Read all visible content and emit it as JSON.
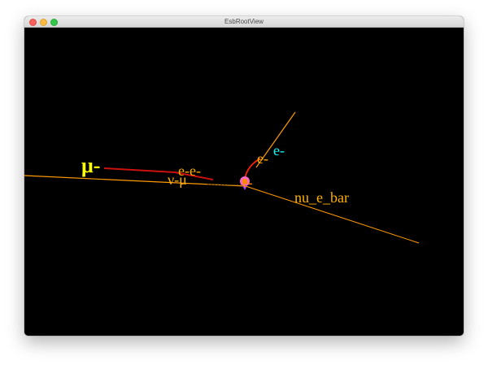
{
  "window": {
    "title": "EsbRootView",
    "background": "#000000"
  },
  "scene": {
    "colors": {
      "muon_track": "#cc1111",
      "orange": "#ff9a00",
      "dashed": "#8a5a00",
      "muon_label": "#ffff00",
      "electron_label": "#ffb000",
      "cyan": "#00ffff",
      "vertex_pink": "#ff66cc",
      "vertex_orange": "#ff8800",
      "vertex_purple": "#aa44ff"
    },
    "labels": {
      "muon": "μ-",
      "electron_pair": "e-e-",
      "nu_mu": "ν-μ",
      "vertex_e": "e-",
      "cyan_e": "e-",
      "vertex_tag": "e-",
      "nu_e_bar": "nu_e_bar"
    }
  }
}
